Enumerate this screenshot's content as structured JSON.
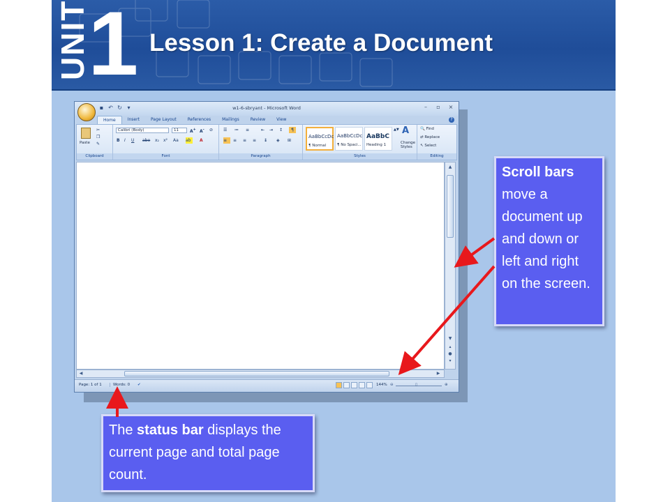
{
  "slide": {
    "unit_word": "UNIT",
    "unit_number": "1",
    "title": "Lesson 1: Create a Document",
    "accent_color": "#1f4d99",
    "background_color": "#a9c6ea"
  },
  "word_window": {
    "title": "w1-6-sbryant - Microsoft Word",
    "tabs": [
      "Home",
      "Insert",
      "Page Layout",
      "References",
      "Mailings",
      "Review",
      "View"
    ],
    "active_tab": "Home",
    "ribbon": {
      "clipboard": {
        "label": "Clipboard",
        "paste_label": "Paste"
      },
      "font": {
        "label": "Font",
        "font_name": "Calibri (Body)",
        "font_size": "11"
      },
      "paragraph": {
        "label": "Paragraph"
      },
      "styles": {
        "label": "Styles",
        "tiles": [
          {
            "sample": "AaBbCcDc",
            "name": "¶ Normal"
          },
          {
            "sample": "AaBbCcDc",
            "name": "¶ No Spaci..."
          },
          {
            "sample": "AaBbC",
            "name": "Heading 1"
          }
        ],
        "change_styles": "Change Styles"
      },
      "editing": {
        "label": "Editing",
        "find": "Find",
        "replace": "Replace",
        "select": "Select"
      }
    },
    "status_bar": {
      "page": "Page: 1 of 1",
      "words": "Words: 0",
      "zoom": "144%"
    }
  },
  "callouts": {
    "scroll": {
      "bold": "Scroll bars",
      "text": " move a document up and down or left and right on the screen."
    },
    "status": {
      "prefix": "The ",
      "bold": "status bar",
      "text": " displays the current page and total page count."
    }
  },
  "colors": {
    "callout_fill": "#5a5ef0",
    "arrow": "#e8181c"
  }
}
